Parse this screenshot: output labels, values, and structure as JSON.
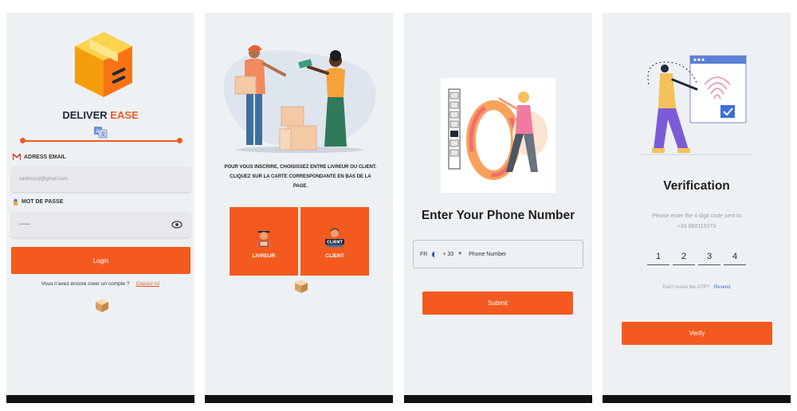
{
  "login": {
    "brand_part1": "DELIVER",
    "brand_part2": "EASE",
    "email_label": "ADRESS EMAIL",
    "email_value": "saidmourji@gmail.com",
    "password_label": "MOT DE PASSE",
    "password_value": "••••••••",
    "login_button": "Login",
    "signup_prompt": "Vous n'avez encore creer un compte ?",
    "signup_link": "Cliquez ici"
  },
  "role_select": {
    "instructions": "POUR VOUS INSCRIRE, CHOISISSEZ ENTRE LIVREUR OU CLIENT. CLIQUEZ SUR LA CARTE CORRESPONDANTE EN BAS DE LA PAGE.",
    "livreur_label": "LIVREUR",
    "client_label": "CLIENT",
    "client_badge": "CLIENT"
  },
  "phone": {
    "title": "Enter Your Phone Number",
    "country_code": "FR",
    "dial_code": "+ 33",
    "placeholder": "Phone Number",
    "submit_button": "Submit"
  },
  "verification": {
    "title": "Verification",
    "subtitle_line1": "Please enter the 4 digit code sent to",
    "subtitle_line2": "+33 660119273",
    "otp": [
      "1",
      "2",
      "3",
      "4"
    ],
    "resend_prompt": "Don't resive the OTP?",
    "resend_link": "Resend",
    "verify_button": "Verify"
  },
  "colors": {
    "accent": "#f45a1f",
    "link": "#3b6fd6",
    "screen_bg": "#eef1f4"
  },
  "icons": [
    "gmail-icon",
    "lock-icon",
    "eye-icon",
    "translate-icon",
    "chevron-down-icon",
    "box-icon"
  ]
}
